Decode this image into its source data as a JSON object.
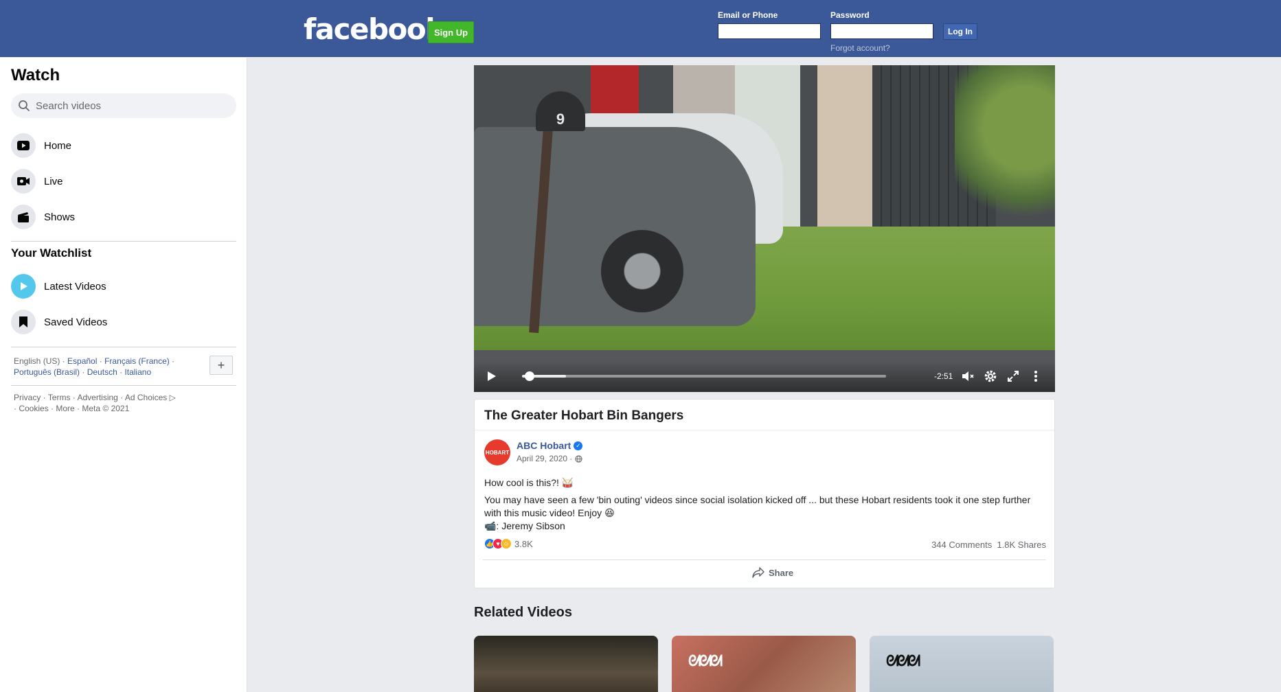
{
  "header": {
    "logo_text": "facebook",
    "signup_label": "Sign Up",
    "email_label": "Email or Phone",
    "password_label": "Password",
    "login_label": "Log In",
    "forgot_label": "Forgot account?",
    "bar_color": "#3b5998"
  },
  "sidebar": {
    "title": "Watch",
    "search_placeholder": "Search videos",
    "nav": [
      {
        "label": "Home",
        "icon": "play-video-icon"
      },
      {
        "label": "Live",
        "icon": "live-camera-icon"
      },
      {
        "label": "Shows",
        "icon": "clapperboard-icon"
      }
    ],
    "watchlist_heading": "Your Watchlist",
    "watchlist": [
      {
        "label": "Latest Videos",
        "icon": "play-circle-icon"
      },
      {
        "label": "Saved Videos",
        "icon": "bookmark-icon"
      }
    ],
    "languages": {
      "current": "English (US)",
      "others": [
        "Español",
        "Français (France)",
        "Português (Brasil)",
        "Deutsch",
        "Italiano"
      ]
    },
    "footer": {
      "links": [
        "Privacy",
        "Terms",
        "Advertising",
        "Ad Choices",
        "Cookies",
        "More"
      ],
      "copyright": "Meta © 2021"
    }
  },
  "video": {
    "mailbox_number": "9",
    "time_remaining": "-2:51",
    "progress": 0.02,
    "buffered": 0.12
  },
  "post": {
    "title": "The Greater Hobart Bin Bangers",
    "page_name": "ABC Hobart",
    "avatar_text": "HOBART",
    "date": "April 29, 2020",
    "line1": "How cool is this?! 🥁",
    "line2": "You may have seen a few 'bin outing' videos since social isolation kicked off ... but these Hobart residents took it one step further with this music video! Enjoy 😆",
    "line3": "📹: Jeremy Sibson",
    "reaction_count": "3.8K",
    "comments": "344 Comments",
    "shares": "1.8K Shares",
    "share_label": "Share"
  },
  "related": {
    "title": "Related Videos"
  }
}
